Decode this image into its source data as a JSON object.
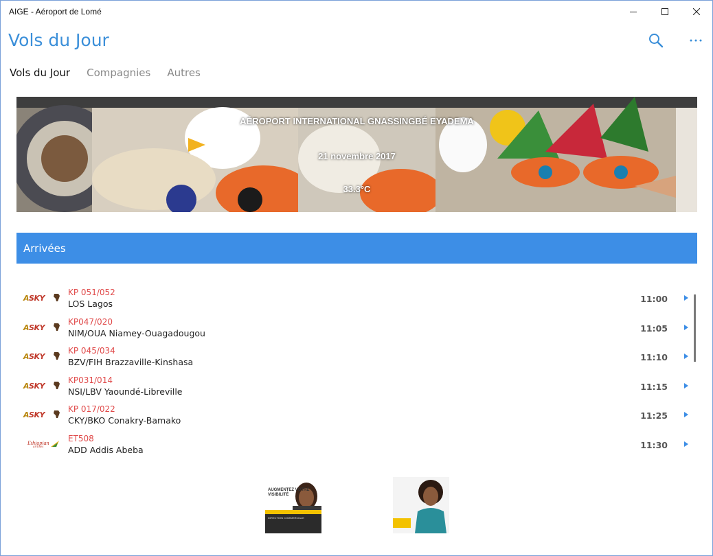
{
  "window": {
    "title": "AIGE - Aéroport de Lomé"
  },
  "app": {
    "title": "Vols du Jour"
  },
  "tabs": [
    {
      "label": "Vols du Jour",
      "active": true
    },
    {
      "label": "Compagnies",
      "active": false
    },
    {
      "label": "Autres",
      "active": false
    }
  ],
  "hero": {
    "airport": "AÉROPORT INTERNATIONAL GNASSINGBÉ EYADEMA",
    "date": "21 novembre 2017",
    "temperature": "33.3°C"
  },
  "section": {
    "title": "Arrivées",
    "color": "#3d8ee6"
  },
  "flights": [
    {
      "airline": "ASKY",
      "logo": "asky-logo",
      "flight": "KP 051/052",
      "route": "LOS Lagos",
      "time": "11:00"
    },
    {
      "airline": "ASKY",
      "logo": "asky-logo",
      "flight": "KP047/020",
      "route": "NIM/OUA Niamey-Ouagadougou",
      "time": "11:05"
    },
    {
      "airline": "ASKY",
      "logo": "asky-logo",
      "flight": "KP 045/034",
      "route": "BZV/FIH Brazzaville-Kinshasa",
      "time": "11:10"
    },
    {
      "airline": "ASKY",
      "logo": "asky-logo",
      "flight": "KP031/014",
      "route": "NSI/LBV Yaoundé-Libreville",
      "time": "11:15"
    },
    {
      "airline": "ASKY",
      "logo": "asky-logo",
      "flight": "KP 017/022",
      "route": "CKY/BKO Conakry-Bamako",
      "time": "11:25"
    },
    {
      "airline": "Ethiopian",
      "logo": "ethiopian-logo",
      "flight": "ET508",
      "route": "ADD Addis Abeba",
      "time": "11:30"
    }
  ],
  "ads": [
    {
      "name": "ad-direction-commerciale",
      "headline": "AUGMENTEZ VOTRE VISIBILITÉ",
      "band": "DIRECTION COMMERCIALE"
    },
    {
      "name": "ad-airport-services"
    }
  ],
  "colors": {
    "accent": "#3b8fd9",
    "flight_number": "#e04a4a"
  }
}
